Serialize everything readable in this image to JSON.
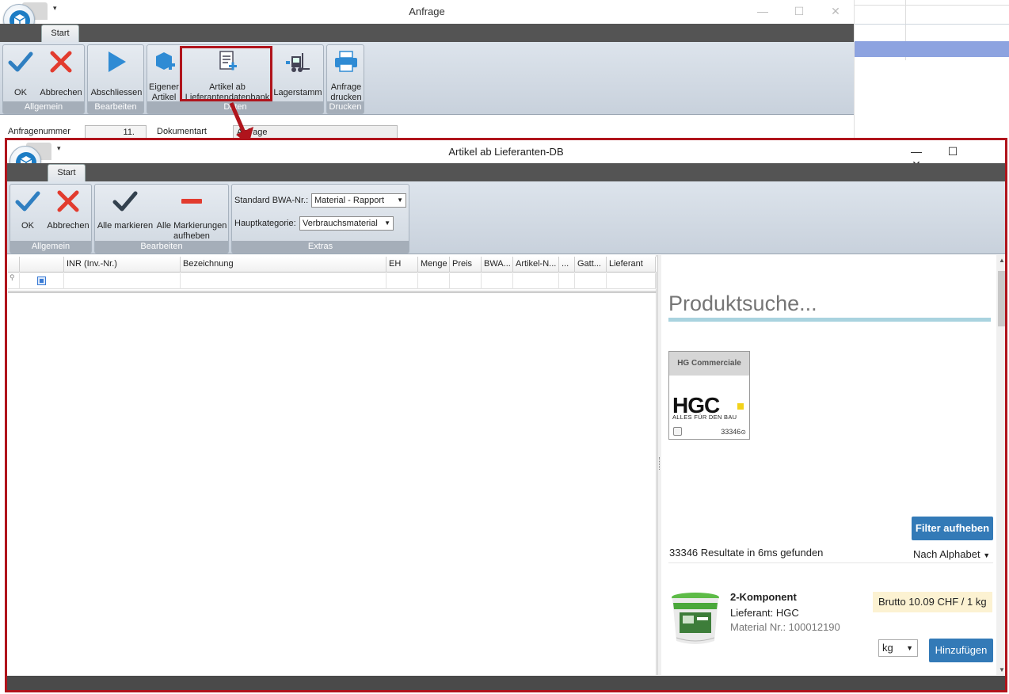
{
  "bg_window": {
    "title": "Anfrage",
    "tab": "Start",
    "ribbon": {
      "groups": [
        {
          "caption": "Allgemein",
          "buttons": [
            {
              "label": "OK"
            },
            {
              "label": "Abbrechen"
            }
          ]
        },
        {
          "caption": "Bearbeiten",
          "buttons": [
            {
              "label": "Abschliessen"
            }
          ]
        },
        {
          "caption": "Daten",
          "buttons": [
            {
              "label": "Eigener Artikel"
            },
            {
              "label": "Artikel ab Lieferantendatenbank"
            },
            {
              "label": "Lagerstamm"
            }
          ]
        },
        {
          "caption": "Drucken",
          "buttons": [
            {
              "label": "Anfrage drucken"
            }
          ]
        }
      ]
    },
    "fields": {
      "anfragenummer_label": "Anfragenummer",
      "anfragenummer_value": "11.",
      "dokumentart_label": "Dokumentart",
      "dokumentart_value": "Anfrage"
    }
  },
  "dialog": {
    "title": "Artikel ab Lieferanten-DB",
    "tab": "Start",
    "ribbon": {
      "allgemein": {
        "caption": "Allgemein",
        "ok": "OK",
        "abbrechen": "Abbrechen"
      },
      "bearbeiten": {
        "caption": "Bearbeiten",
        "alle_markieren": "Alle markieren",
        "alle_markierungen_aufheben": "Alle Markierungen aufheben"
      },
      "extras": {
        "caption": "Extras",
        "standard_bwa_label": "Standard BWA-Nr.:",
        "standard_bwa_value": "Material - Rapport",
        "hauptkategorie_label": "Hauptkategorie:",
        "hauptkategorie_value": "Verbrauchsmaterial"
      }
    },
    "grid": {
      "columns": [
        "",
        "INR (Inv.-Nr.)",
        "Bezeichnung",
        "EH",
        "Menge",
        "Preis",
        "BWA...",
        "Artikel-N...",
        "...",
        "Gatt...",
        "Lieferant"
      ]
    },
    "search": {
      "placeholder": "Produktsuche...",
      "supplier_card": {
        "name": "HG Commerciale",
        "logo_text": "HGC",
        "tagline": "ALLES FÜR DEN BAU",
        "count": "33346"
      },
      "filter_button": "Filter aufheben",
      "result_summary": "33346 Resultate in 6ms gefunden",
      "sort_label": "Nach Alphabet",
      "product": {
        "name": "2-Komponent",
        "supplier": "Lieferant: HGC",
        "material_nr": "Material Nr.: 100012190",
        "price": "Brutto 10.09 CHF / 1 kg",
        "unit": "kg",
        "add_button": "Hinzufügen"
      }
    }
  },
  "colors": {
    "highlight": "#b0141c",
    "accent_blue": "#337ab7",
    "search_underline": "#a9d3df",
    "price_bg": "#fcf2d2"
  }
}
